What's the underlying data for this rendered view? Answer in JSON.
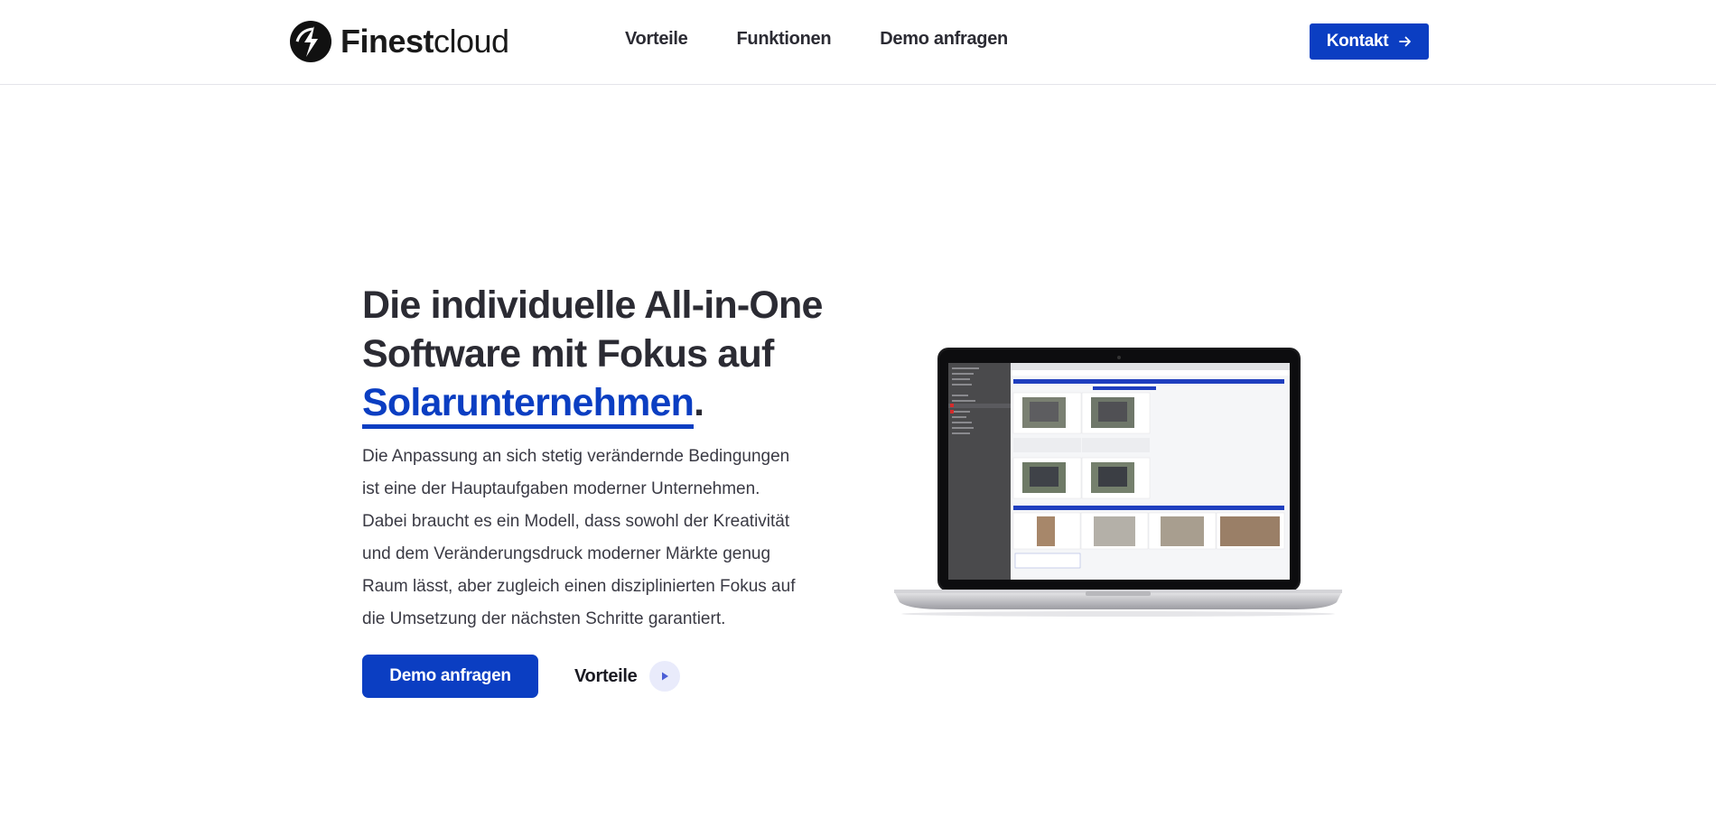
{
  "brand": {
    "name_bold": "Finest",
    "name_light": "cloud"
  },
  "nav": {
    "items": [
      "Vorteile",
      "Funktionen",
      "Demo anfragen"
    ]
  },
  "header": {
    "contact_label": "Kontakt"
  },
  "hero": {
    "headline_line1": "Die individuelle All-in-One",
    "headline_line2": "Software mit Fokus auf",
    "headline_accent": "Solarunternehmen",
    "headline_period": ".",
    "body_lines": [
      "Die Anpassung an sich stetig verändernde Bedingungen",
      "ist eine der Hauptaufgaben moderner Unternehmen.",
      "Dabei braucht es ein Modell, dass sowohl der Kreativität",
      "und dem Veränderungsdruck moderner Märkte genug",
      "Raum lässt, aber zugleich einen disziplinierten Fokus auf",
      "die Umsetzung der nächsten Schritte garantiert."
    ],
    "primary_button": "Demo anfragen",
    "secondary_link": "Vorteile"
  },
  "colors": {
    "accent": "#0b3ec2",
    "text": "#2b2b33",
    "play_bg": "#e9ebfb"
  },
  "icons": {
    "logo": "finestcloud-logo-icon",
    "contact_arrow": "arrow-right-icon",
    "play": "play-icon",
    "laptop": "laptop-screenshot-image"
  }
}
